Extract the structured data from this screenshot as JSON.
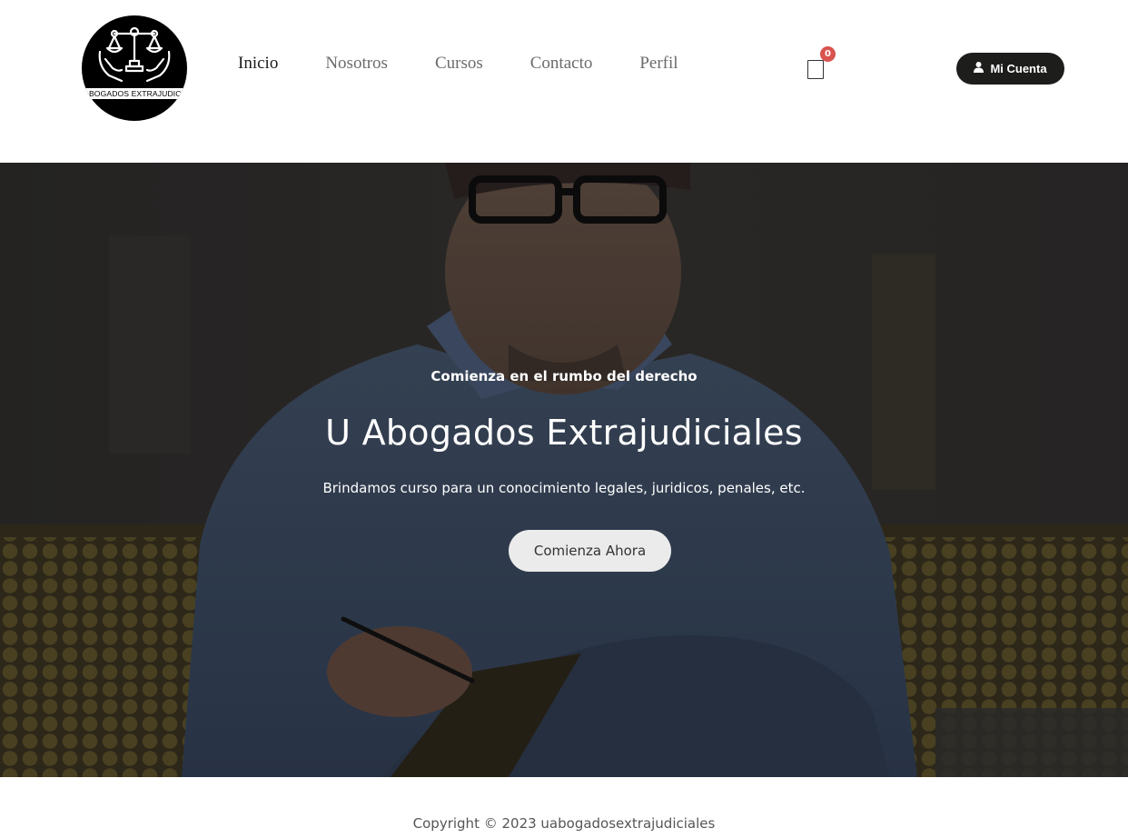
{
  "brand": {
    "logo_text": "ABOGADOS EXTRAJUDICIA",
    "logo_icon": "scales-in-hands-icon"
  },
  "nav": {
    "items": [
      {
        "label": "Inicio",
        "active": true
      },
      {
        "label": "Nosotros",
        "active": false
      },
      {
        "label": "Cursos",
        "active": false
      },
      {
        "label": "Contacto",
        "active": false
      },
      {
        "label": "Perfil",
        "active": false
      }
    ]
  },
  "cart": {
    "count": "0",
    "icon": "cart-icon",
    "badge_color": "#d9534f"
  },
  "account": {
    "label": "Mi Cuenta",
    "icon": "user-icon",
    "background": "#1d1e1c"
  },
  "hero": {
    "kicker": "Comienza en el rumbo del derecho",
    "title": "U Abogados Extrajudiciales",
    "subtitle": "Brindamos curso para un conocimiento legales, juridicos, penales, etc.",
    "cta_label": "Comienza Ahora"
  },
  "footer": {
    "copyright": "Copyright © 2023 uabogadosextrajudiciales"
  }
}
